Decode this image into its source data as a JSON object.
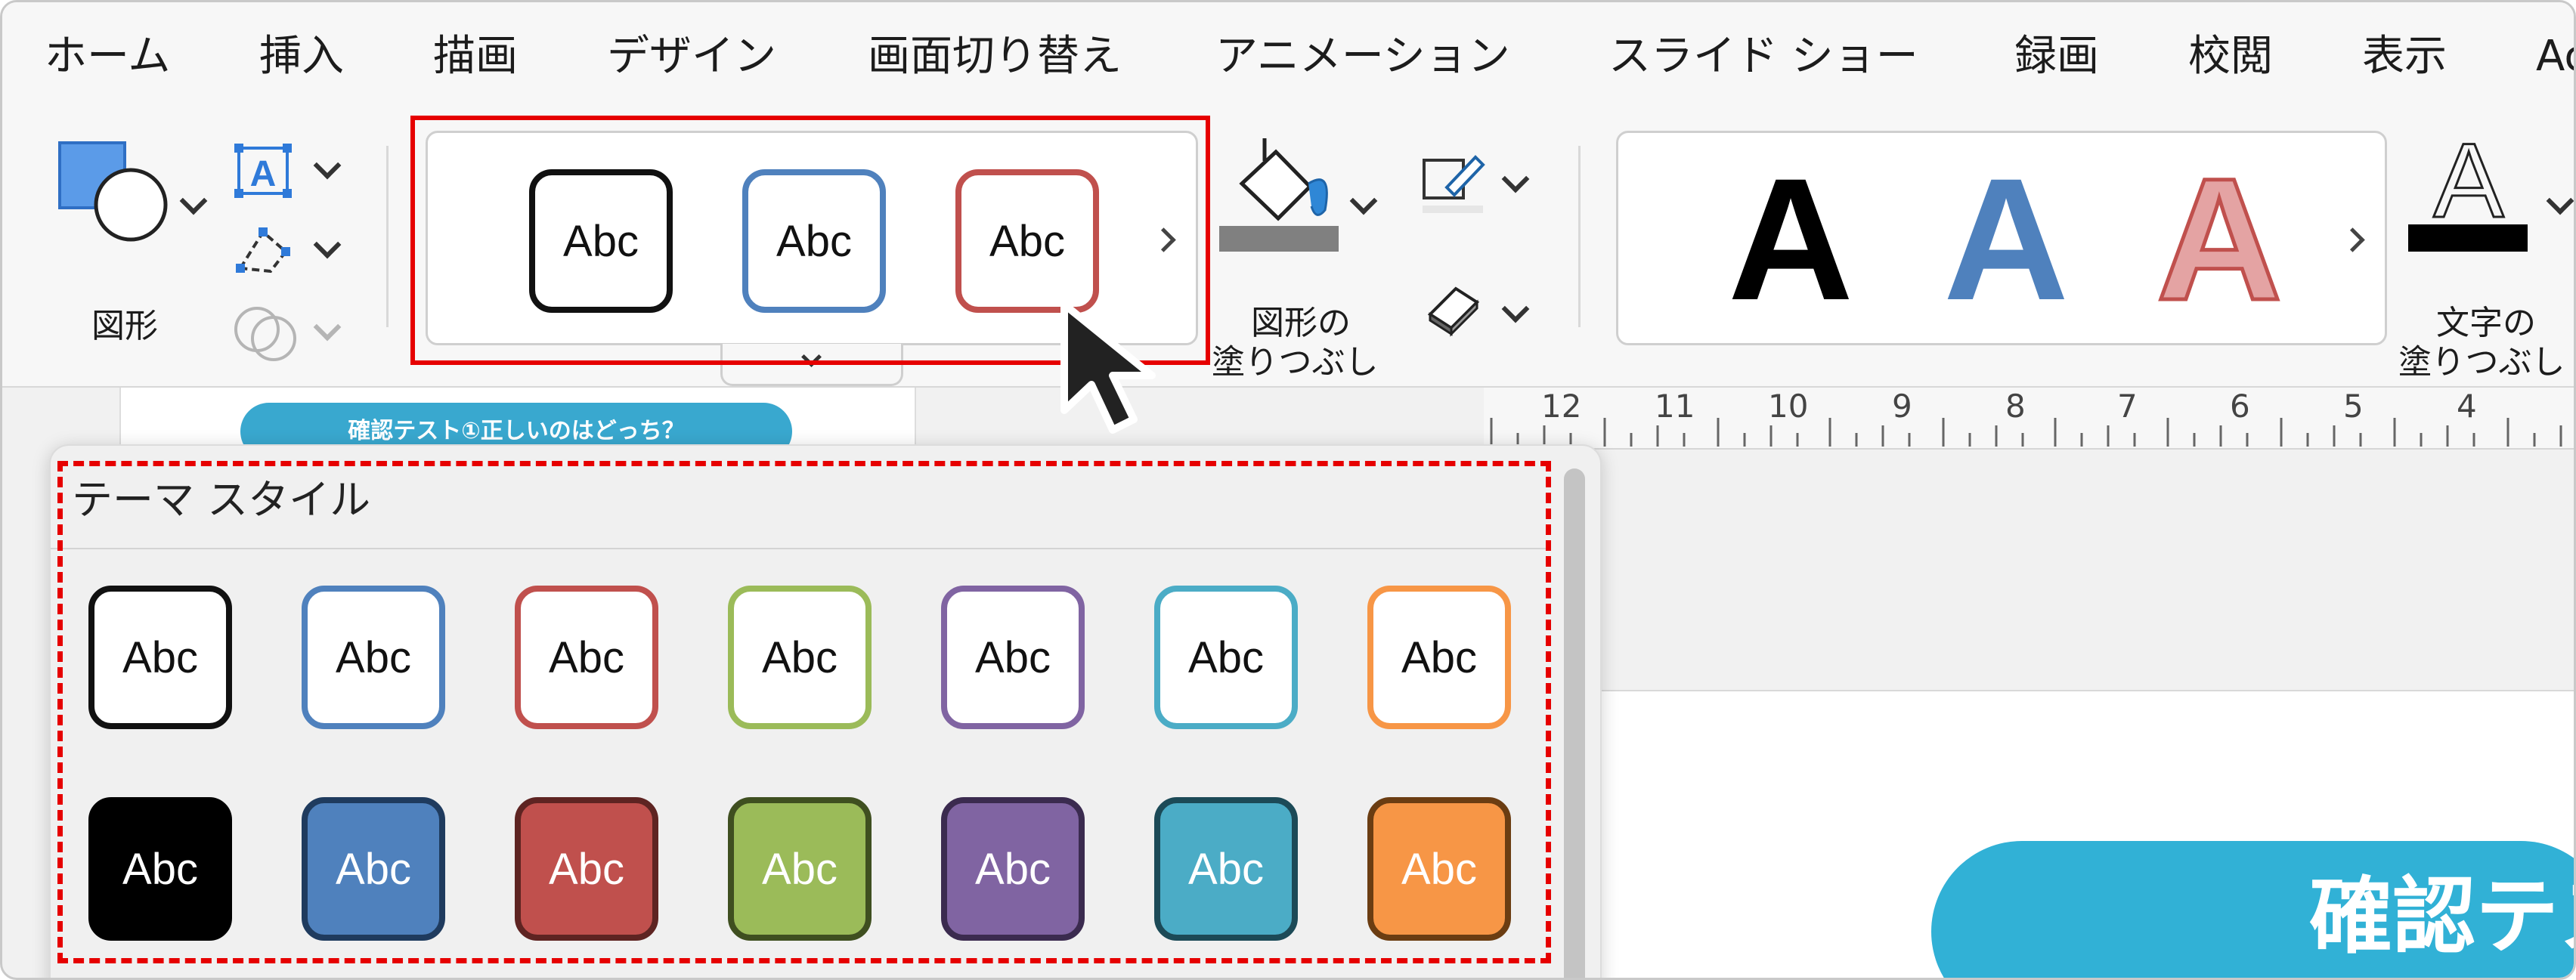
{
  "menu": {
    "tabs": [
      "ホーム",
      "挿入",
      "描画",
      "デザイン",
      "画面切り替え",
      "アニメーション",
      "スライド ショー",
      "録画",
      "校閲",
      "表示",
      "Ac"
    ]
  },
  "ribbon": {
    "shapes_label": "図形",
    "text_box_glyph": "A",
    "quick_style_label": "Abc",
    "fill_label_line1": "図形の",
    "fill_label_line2": "塗りつぶし",
    "wordart_glyph": "A",
    "text_fill_label_line1": "文字の",
    "text_fill_label_line2": "塗りつぶし"
  },
  "ruler": {
    "numbers": [
      "12",
      "11",
      "10",
      "9",
      "8",
      "7",
      "6",
      "5",
      "4"
    ]
  },
  "slide": {
    "thumbnail_title": "確認テスト①正しいのはどっち？",
    "banner_text": "確認テス"
  },
  "panel": {
    "title": "テーマ スタイル",
    "style_label": "Abc"
  },
  "colors": {
    "highlight": "#e60000",
    "black": "#000000",
    "blue": "#4f81bd",
    "red": "#c0504d",
    "green": "#9bbb59",
    "purple": "#8064a2",
    "aqua": "#4bacc6",
    "orange": "#f79646"
  }
}
